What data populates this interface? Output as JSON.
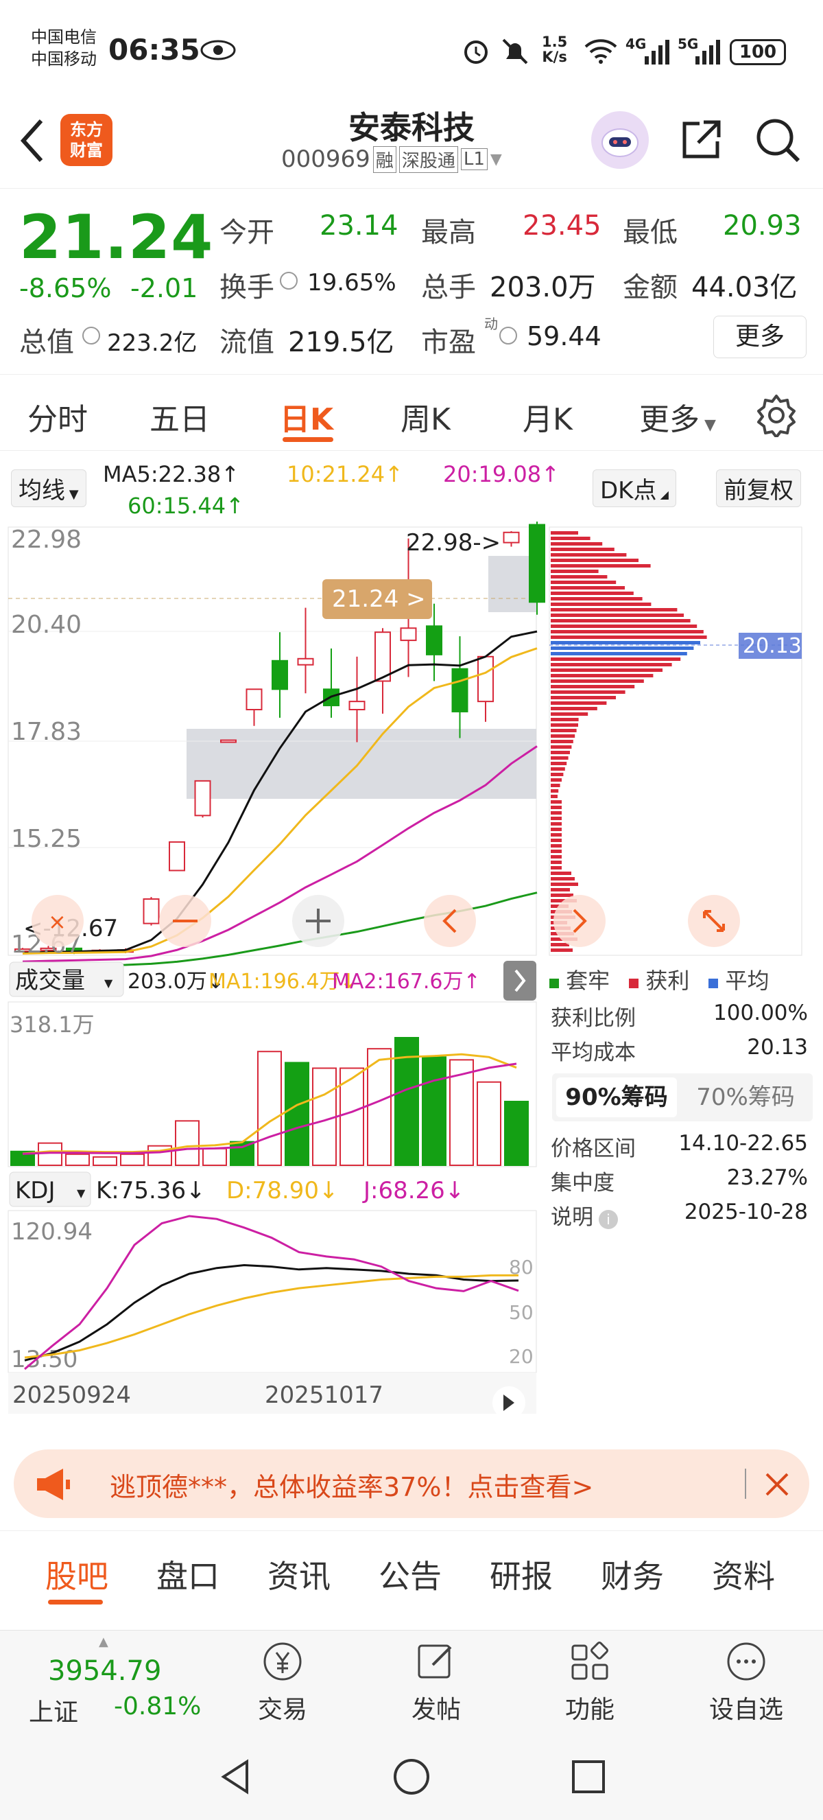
{
  "status": {
    "carrier1": "中国电信",
    "carrier2": "中国移动",
    "time": "06:35",
    "speed": "1.5",
    "speed_unit": "K/s",
    "sig1": "4G",
    "sig2": "5G",
    "battery": "100"
  },
  "nav": {
    "title": "安泰科技",
    "code": "000969",
    "badges": [
      "融",
      "深股通",
      "L1"
    ],
    "logo_line1": "东方",
    "logo_line2": "财富"
  },
  "quote": {
    "price": "21.24",
    "change_pct": "-8.65%",
    "change": "-2.01",
    "open_label": "今开",
    "open": "23.14",
    "high_label": "最高",
    "high": "23.45",
    "low_label": "最低",
    "low": "20.93",
    "turnover_label": "换手",
    "turnover": "19.65%",
    "volume_label": "总手",
    "volume": "203.0万",
    "amount_label": "金额",
    "amount": "44.03亿",
    "mktcap_label": "总值",
    "mktcap": "223.2亿",
    "float_label": "流值",
    "float": "219.5亿",
    "pe_label": "市盈",
    "pe_sup": "动",
    "pe": "59.44",
    "more": "更多"
  },
  "tabs": [
    "分时",
    "五日",
    "日K",
    "周K",
    "月K",
    "更多"
  ],
  "active_tab": "日K",
  "ma": {
    "selector": "均线",
    "ma5": "MA5:22.38↑",
    "ma10": "10:21.24↑",
    "ma20": "20:19.08↑",
    "ma60": "60:15.44↑",
    "dk": "DK点",
    "fq": "前复权"
  },
  "kchart": {
    "price_labels": [
      "22.98",
      "20.40",
      "17.83",
      "15.25",
      "12.67"
    ],
    "max_label": "22.98->",
    "current_tag": "21.24 >",
    "min_label": "<-12.67",
    "cost_tag": "20.13",
    "colors": {
      "up": "#d8293a",
      "down": "#14a014",
      "ma5": "#111111",
      "ma10": "#f0b81c",
      "ma20": "#cc1fa3",
      "ma60": "#1a9a1a"
    }
  },
  "chart_data": {
    "type": "candlestick",
    "ylim": [
      12.67,
      22.98
    ],
    "candles": [
      {
        "o": 12.68,
        "h": 12.75,
        "l": 12.64,
        "c": 12.72
      },
      {
        "o": 12.7,
        "h": 12.8,
        "l": 12.66,
        "c": 12.74
      },
      {
        "o": 12.74,
        "h": 12.76,
        "l": 12.6,
        "c": 12.64
      },
      {
        "o": 12.66,
        "h": 12.72,
        "l": 12.62,
        "c": 12.69
      },
      {
        "o": 12.68,
        "h": 12.74,
        "l": 12.62,
        "c": 12.7
      },
      {
        "o": 13.35,
        "h": 14.0,
        "l": 13.3,
        "c": 13.95
      },
      {
        "o": 14.65,
        "h": 15.35,
        "l": 14.65,
        "c": 15.35
      },
      {
        "o": 16.0,
        "h": 16.85,
        "l": 15.95,
        "c": 16.85
      },
      {
        "o": 17.8,
        "h": 17.85,
        "l": 17.8,
        "c": 17.85
      },
      {
        "o": 18.6,
        "h": 19.1,
        "l": 18.2,
        "c": 19.1
      },
      {
        "o": 19.8,
        "h": 20.5,
        "l": 18.4,
        "c": 19.1
      },
      {
        "o": 19.7,
        "h": 21.1,
        "l": 19.0,
        "c": 19.85
      },
      {
        "o": 19.1,
        "h": 20.1,
        "l": 18.4,
        "c": 18.7
      },
      {
        "o": 18.6,
        "h": 19.9,
        "l": 17.8,
        "c": 18.8
      },
      {
        "o": 19.3,
        "h": 20.6,
        "l": 18.5,
        "c": 20.5
      },
      {
        "o": 20.3,
        "h": 22.8,
        "l": 19.4,
        "c": 20.6
      },
      {
        "o": 20.65,
        "h": 21.2,
        "l": 19.3,
        "c": 19.95
      },
      {
        "o": 19.6,
        "h": 20.4,
        "l": 17.9,
        "c": 18.55
      },
      {
        "o": 18.8,
        "h": 19.9,
        "l": 18.3,
        "c": 19.9
      },
      {
        "o": 22.7,
        "h": 22.98,
        "l": 22.6,
        "c": 22.95
      },
      {
        "o": 23.14,
        "h": 23.45,
        "l": 20.93,
        "c": 21.24
      }
    ],
    "volume": [
      50,
      80,
      40,
      30,
      40,
      70,
      160,
      60,
      85,
      410,
      370,
      350,
      350,
      420,
      460,
      390,
      380,
      300,
      230
    ],
    "kdj": {
      "labels": [
        "K:75.36↓",
        "D:78.90↓",
        "J:68.26↓"
      ],
      "ylim": [
        13.5,
        120.94
      ]
    },
    "volume_title": "成交量",
    "volume_labels": [
      "203.0万↓",
      "MA1:196.4万↓",
      "MA2:167.6万↑"
    ],
    "volume_max": "318.1万",
    "kdj_axis": [
      "80",
      "50",
      "20"
    ],
    "x_labels": [
      "20250924",
      "20251017"
    ]
  },
  "chips": {
    "legend": [
      "套牢",
      "获利",
      "平均"
    ],
    "profit_label": "获利比例",
    "profit": "100.00%",
    "cost_label": "平均成本",
    "cost": "20.13",
    "tab90": "90%筹码",
    "tab70": "70%筹码",
    "range_label": "价格区间",
    "range": "14.10-22.65",
    "conc_label": "集中度",
    "conc": "23.27%",
    "note_label": "说明",
    "note": "2025-10-28"
  },
  "banner": "逃顶德***，总体收益率37%！点击查看>",
  "subtabs": [
    "股吧",
    "盘口",
    "资讯",
    "公告",
    "研报",
    "财务",
    "资料"
  ],
  "bottom": {
    "index": "3954.79",
    "index_name": "上证",
    "index_chg": "-0.81%",
    "items": [
      "交易",
      "发帖",
      "功能",
      "设自选"
    ]
  }
}
